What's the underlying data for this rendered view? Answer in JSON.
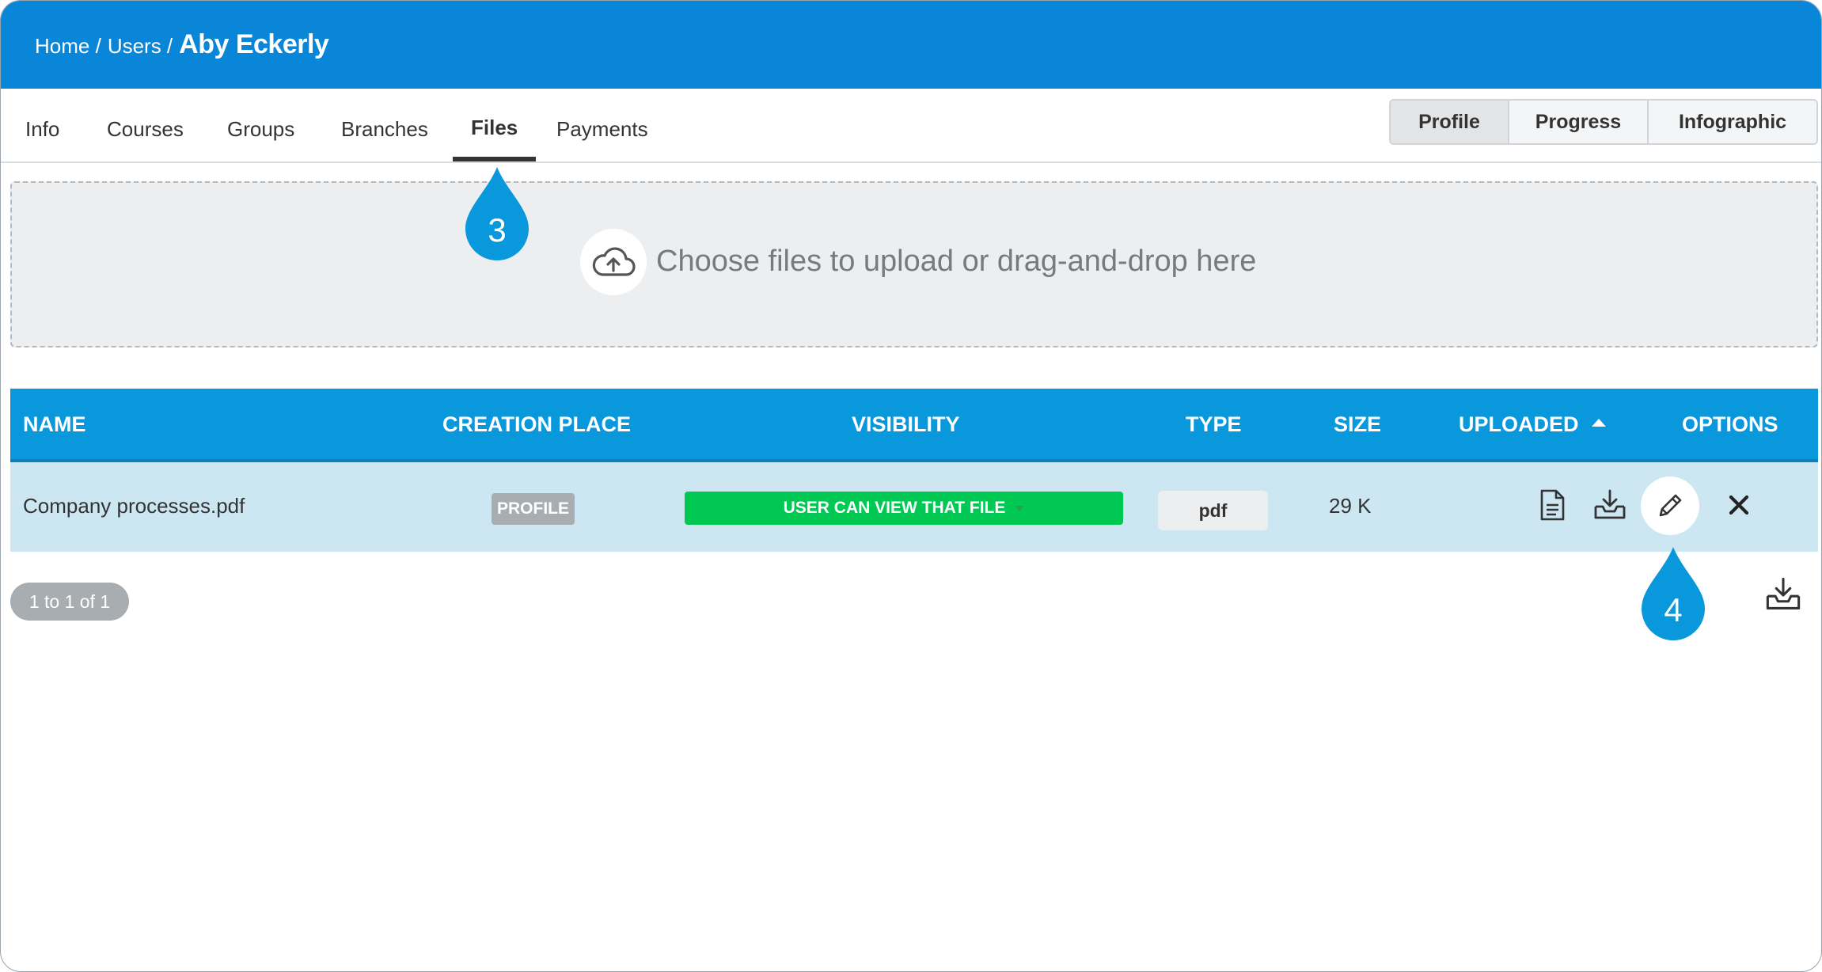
{
  "breadcrumb": {
    "home": "Home /",
    "users": "Users /",
    "current": "Aby Eckerly"
  },
  "tabs": [
    {
      "label": "Info"
    },
    {
      "label": "Courses"
    },
    {
      "label": "Groups"
    },
    {
      "label": "Branches"
    },
    {
      "label": "Files",
      "active": true
    },
    {
      "label": "Payments"
    }
  ],
  "view_switch": [
    {
      "label": "Profile",
      "active": true
    },
    {
      "label": "Progress"
    },
    {
      "label": "Infographic"
    }
  ],
  "upload": {
    "text": "Choose files to upload or drag-and-drop here",
    "icon": "cloud-upload-icon"
  },
  "table": {
    "columns": {
      "name": "NAME",
      "creation_place": "CREATION PLACE",
      "visibility": "VISIBILITY",
      "type": "TYPE",
      "size": "SIZE",
      "uploaded": "UPLOADED",
      "options": "OPTIONS"
    },
    "rows": [
      {
        "name": "Company processes.pdf",
        "creation_place": "PROFILE",
        "visibility": "USER CAN VIEW THAT FILE",
        "type": "pdf",
        "size": "29 K"
      }
    ]
  },
  "pagination": {
    "text": "1 to 1 of 1"
  },
  "callouts": {
    "one": "3",
    "two": "4"
  },
  "colors": {
    "header": "#0a86d8",
    "table_header": "#0a98dc",
    "row": "#cce6f2",
    "visibility": "#00c853",
    "callout": "#0a98dc"
  }
}
